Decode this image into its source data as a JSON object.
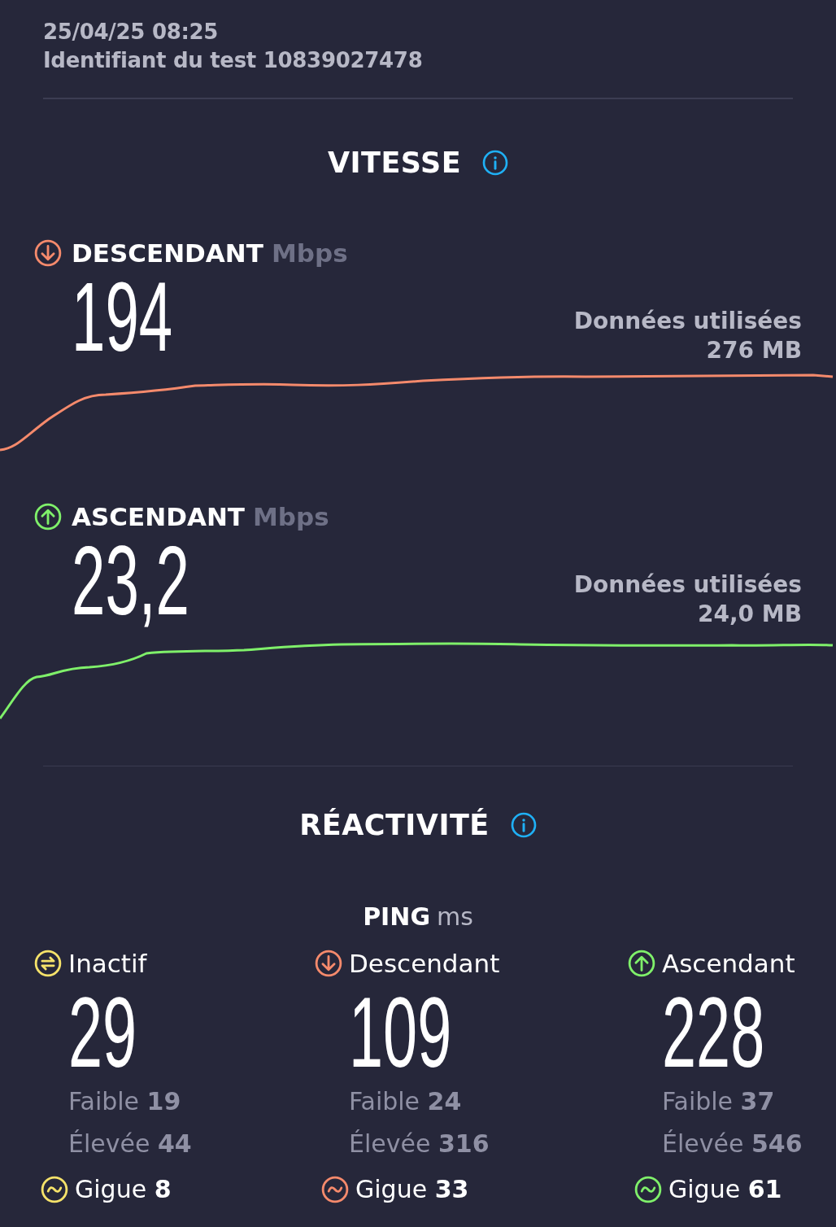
{
  "header": {
    "date": "25/04/25 08:25",
    "test_id": "Identifiant du test 10839027478"
  },
  "speed": {
    "title": "VITESSE",
    "metrics": [
      {
        "kind": "download",
        "label": "DESCENDANT",
        "unit": "Mbps",
        "value": "194",
        "data_label": "Données utilisées",
        "data_value": "276 MB"
      },
      {
        "kind": "upload",
        "label": "ASCENDANT",
        "unit": "Mbps",
        "value": "23,2",
        "data_label": "Données utilisées",
        "data_value": "24,0 MB"
      }
    ]
  },
  "responsiveness": {
    "title": "RÉACTIVITÉ",
    "ping": {
      "label": "PING",
      "unit": "ms"
    },
    "columns": [
      {
        "kind": "idle",
        "label": "Inactif",
        "value": "29",
        "low": "Faible **19**",
        "high": "Élevée **44**",
        "jitter": "Gigue **8**"
      },
      {
        "kind": "download",
        "label": "Descendant",
        "value": "109",
        "low": "Faible **24**",
        "high": "Élevée **316**",
        "jitter": "Gigue **33**"
      },
      {
        "kind": "upload",
        "label": "Ascendant",
        "value": "228",
        "low": "Faible **37**",
        "high": "Élevée **546**",
        "jitter": "Gigue **61**"
      }
    ]
  }
}
